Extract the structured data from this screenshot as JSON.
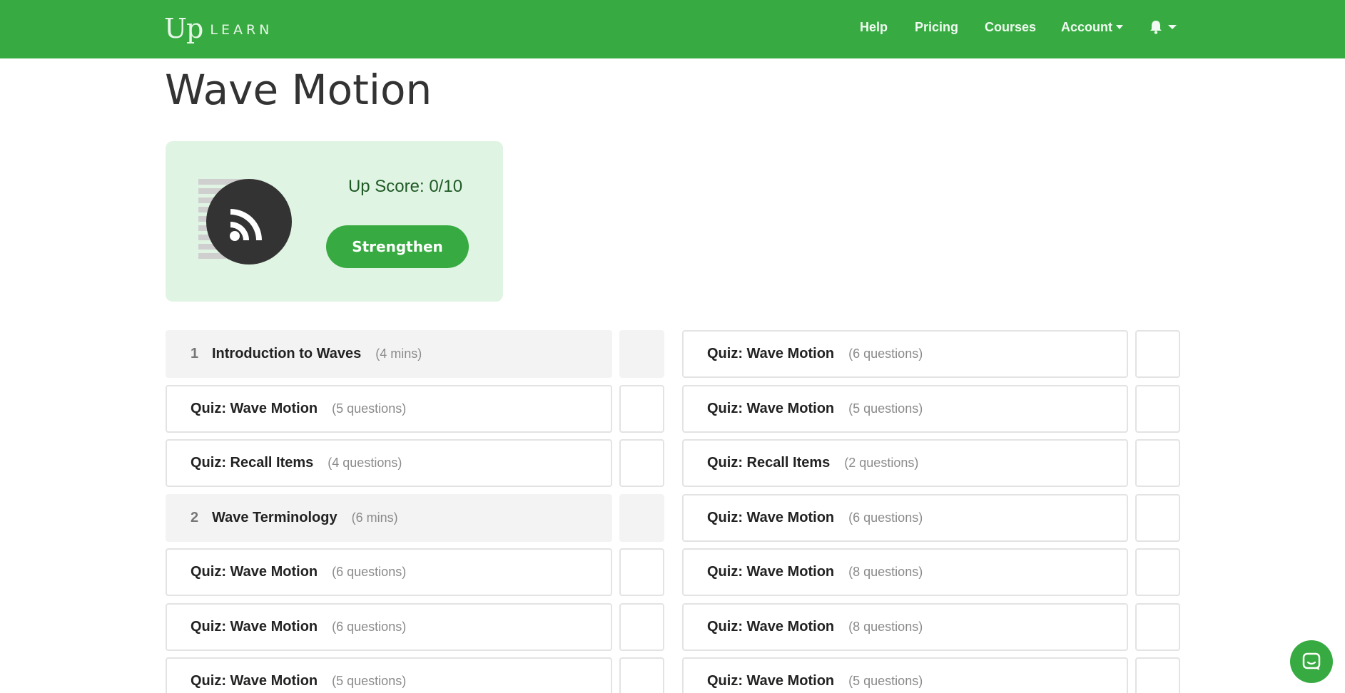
{
  "header": {
    "logo_up": "Up",
    "logo_learn": "LEARN",
    "nav": {
      "help": "Help",
      "pricing": "Pricing",
      "courses": "Courses",
      "account": "Account"
    },
    "bell_icon": "bell-icon"
  },
  "page": {
    "title": "Wave Motion"
  },
  "score_card": {
    "icon": "rss-icon",
    "score_label": "Up Score: 0/10",
    "strengthen_label": "Strengthen"
  },
  "left_items": [
    {
      "type": "lesson",
      "number": "1",
      "name": "Introduction to Waves",
      "meta": "(4 mins)"
    },
    {
      "type": "quiz",
      "name": "Quiz: Wave Motion",
      "meta": "(5 questions)"
    },
    {
      "type": "quiz",
      "name": "Quiz: Recall Items",
      "meta": "(4 questions)"
    },
    {
      "type": "lesson",
      "number": "2",
      "name": "Wave Terminology",
      "meta": "(6 mins)"
    },
    {
      "type": "quiz",
      "name": "Quiz: Wave Motion",
      "meta": "(6 questions)"
    },
    {
      "type": "quiz",
      "name": "Quiz: Wave Motion",
      "meta": "(6 questions)"
    },
    {
      "type": "quiz",
      "name": "Quiz: Wave Motion",
      "meta": "(5 questions)"
    }
  ],
  "right_items": [
    {
      "type": "quiz",
      "name": "Quiz: Wave Motion",
      "meta": "(6 questions)"
    },
    {
      "type": "quiz",
      "name": "Quiz: Wave Motion",
      "meta": "(5 questions)"
    },
    {
      "type": "quiz",
      "name": "Quiz: Recall Items",
      "meta": "(2 questions)"
    },
    {
      "type": "quiz",
      "name": "Quiz: Wave Motion",
      "meta": "(6 questions)"
    },
    {
      "type": "quiz",
      "name": "Quiz: Wave Motion",
      "meta": "(8 questions)"
    },
    {
      "type": "quiz",
      "name": "Quiz: Wave Motion",
      "meta": "(8 questions)"
    },
    {
      "type": "quiz",
      "name": "Quiz: Wave Motion",
      "meta": "(5 questions)"
    }
  ],
  "chat": {
    "icon": "chat-icon"
  },
  "colors": {
    "brand_green": "#37ab41",
    "card_bg": "#e0f4e3",
    "lesson_bg": "#f3f3f3"
  }
}
